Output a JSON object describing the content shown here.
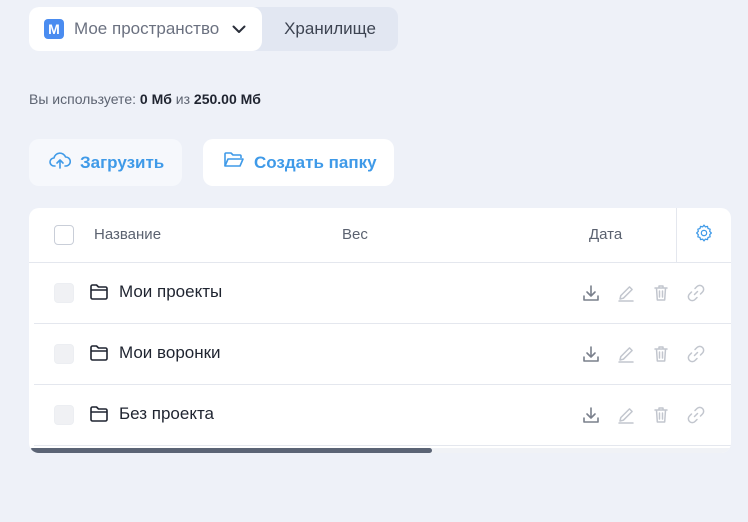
{
  "header": {
    "space_badge": "М",
    "space_name": "Мое пространство",
    "storage_tab": "Хранилище"
  },
  "usage": {
    "prefix": "Вы используете:",
    "used": "0 Мб",
    "of": "из",
    "total": "250.00 Мб"
  },
  "actions": {
    "upload_label": "Загрузить",
    "create_folder_label": "Создать папку"
  },
  "table": {
    "columns": {
      "name": "Название",
      "weight": "Вес",
      "date": "Дата"
    },
    "rows": [
      {
        "name": "Мои проекты"
      },
      {
        "name": "Мои воронки"
      },
      {
        "name": "Без проекта"
      }
    ],
    "scroll_position_fraction": 0.57
  },
  "icons": {
    "upload": "cloud-upload-icon",
    "folder": "folder-icon",
    "download": "download-icon",
    "edit": "pencil-icon",
    "delete": "trash-icon",
    "link": "link-icon",
    "settings": "gear-icon",
    "chevron": "chevron-down-icon"
  },
  "colors": {
    "background": "#eef1f8",
    "accent": "#3f9ae8",
    "badge": "#4a8cf0"
  }
}
